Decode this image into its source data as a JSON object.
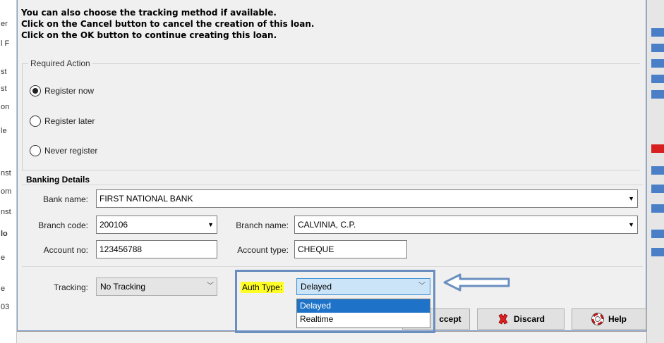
{
  "instructions": [
    "You can also choose the tracking method if available.",
    "Click on the Cancel button to cancel the creation of this loan.",
    "Click on the OK button to continue creating this loan."
  ],
  "background_fragments": [
    "er",
    "l F",
    "st",
    "st",
    "on",
    "le",
    "nst",
    "om",
    "nst",
    "lo",
    "e",
    "e",
    "03"
  ],
  "required_action": {
    "legend": "Required Action",
    "options": [
      {
        "label": "Register now",
        "checked": true
      },
      {
        "label": "Register later",
        "checked": false
      },
      {
        "label": "Never register",
        "checked": false
      }
    ]
  },
  "banking": {
    "title": "Banking Details",
    "bank_name_label": "Bank name:",
    "bank_name_value": "FIRST NATIONAL BANK",
    "branch_code_label": "Branch code:",
    "branch_code_value": "200106",
    "branch_name_label": "Branch name:",
    "branch_name_value": "CALVINIA, C.P.",
    "account_no_label": "Account no:",
    "account_no_value": "123456788",
    "account_type_label": "Account type:",
    "account_type_value": "CHEQUE"
  },
  "tracking": {
    "label": "Tracking:",
    "value": "No Tracking",
    "auth_type_label": "Auth Type:",
    "auth_type_value": "Delayed",
    "auth_type_options": [
      "Delayed",
      "Realtime"
    ],
    "auth_type_selected_index": 0
  },
  "buttons": {
    "accept_label": "ccept",
    "discard_label": "Discard",
    "help_label": "Help"
  },
  "icons": {
    "dropdown": "chevron-down-icon",
    "discard": "red-x-icon",
    "help": "lifebuoy-icon",
    "callout": "left-arrow-icon"
  },
  "colors": {
    "highlight": "#ffff26",
    "selection": "#1e73c8",
    "callout": "#6a8fbf",
    "focused_combo": "#cce4f7"
  }
}
